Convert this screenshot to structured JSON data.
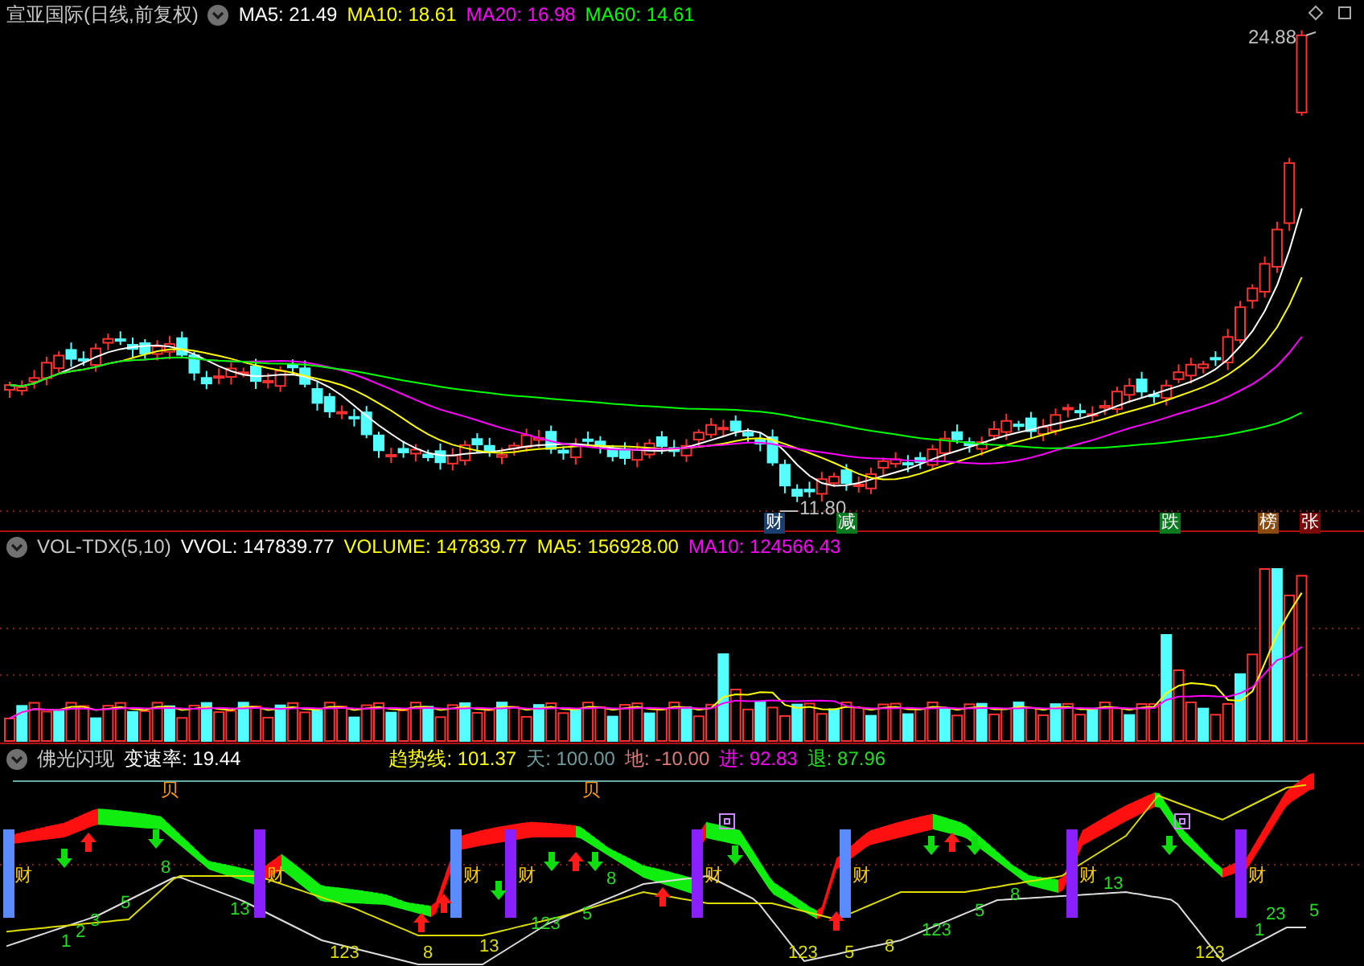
{
  "main_panel": {
    "title": "宣亚国际(日线,前复权)",
    "indicators": [
      {
        "label": "MA5: 21.49",
        "color": "#ffffff"
      },
      {
        "label": "MA10: 18.61",
        "color": "#ffff00"
      },
      {
        "label": "MA20: 16.98",
        "color": "#ff00ff"
      },
      {
        "label": "MA60: 14.61",
        "color": "#00ff00"
      }
    ],
    "annotations": [
      {
        "text": "24.88"
      },
      {
        "text": "11.80"
      }
    ],
    "markers": [
      {
        "text": "财",
        "color": "#1b3f6e"
      },
      {
        "text": "减",
        "color": "#0a7a1e"
      },
      {
        "text": "跌",
        "color": "#0a7a1e"
      },
      {
        "text": "榜",
        "color": "#8a4a10"
      },
      {
        "text": "张",
        "color": "#7a0a0a"
      }
    ]
  },
  "volume_panel": {
    "title": "VOL-TDX(5,10)",
    "readings": [
      {
        "label": "VVOL: 147839.77",
        "color": "#ffffff"
      },
      {
        "label": "VOLUME: 147839.77",
        "color": "#ffff00"
      },
      {
        "label": "MA5: 156928.00",
        "color": "#ffff00"
      },
      {
        "label": "MA10: 124566.43",
        "color": "#ff00ff"
      }
    ]
  },
  "indicator_panel": {
    "title": "佛光闪现",
    "rate": "变速率: 19.44",
    "readings": [
      {
        "label": "趋势线: 101.37",
        "color": "#ffff00"
      },
      {
        "label": "天: 100.00",
        "color": "#6f9c9c"
      },
      {
        "label": "地: -10.00",
        "color": "#e07a7a"
      },
      {
        "label": "进: 92.83",
        "color": "#ff00ff"
      },
      {
        "label": "退: 87.96",
        "color": "#22dd22"
      }
    ],
    "labels": [
      {
        "text": "财",
        "color": "#ffcc00"
      },
      {
        "text": "财",
        "color": "#ffcc00"
      },
      {
        "text": "财",
        "color": "#ffcc00"
      },
      {
        "text": "财",
        "color": "#ffcc00"
      },
      {
        "text": "财",
        "color": "#ffcc00"
      },
      {
        "text": "财",
        "color": "#ffcc00"
      },
      {
        "text": "财",
        "color": "#ffcc00"
      },
      {
        "text": "财",
        "color": "#ffcc00"
      },
      {
        "text": "贝",
        "color": "#ff9900"
      },
      {
        "text": "贝",
        "color": "#ff9900"
      },
      {
        "text": "1",
        "color": "#22dd22"
      },
      {
        "text": "2",
        "color": "#22dd22"
      },
      {
        "text": "3",
        "color": "#22dd22"
      },
      {
        "text": "5",
        "color": "#22dd22"
      },
      {
        "text": "8",
        "color": "#22dd22"
      },
      {
        "text": "13",
        "color": "#22dd22"
      },
      {
        "text": "123",
        "color": "#22dd22"
      },
      {
        "text": "5",
        "color": "#22dd22"
      },
      {
        "text": "8",
        "color": "#22dd22"
      },
      {
        "text": "123",
        "color": "#22dd22"
      },
      {
        "text": "5",
        "color": "#22dd22"
      },
      {
        "text": "8",
        "color": "#22dd22"
      },
      {
        "text": "13",
        "color": "#22dd22"
      },
      {
        "text": "1",
        "color": "#22dd22"
      },
      {
        "text": "23",
        "color": "#22dd22"
      },
      {
        "text": "5",
        "color": "#22dd22"
      },
      {
        "text": "123",
        "color": "#dddd00"
      },
      {
        "text": "8",
        "color": "#dddd00"
      },
      {
        "text": "13",
        "color": "#dddd00"
      },
      {
        "text": "123",
        "color": "#dddd00"
      },
      {
        "text": "5",
        "color": "#dddd00"
      },
      {
        "text": "8",
        "color": "#dddd00"
      },
      {
        "text": "123",
        "color": "#dddd00"
      }
    ]
  }
}
